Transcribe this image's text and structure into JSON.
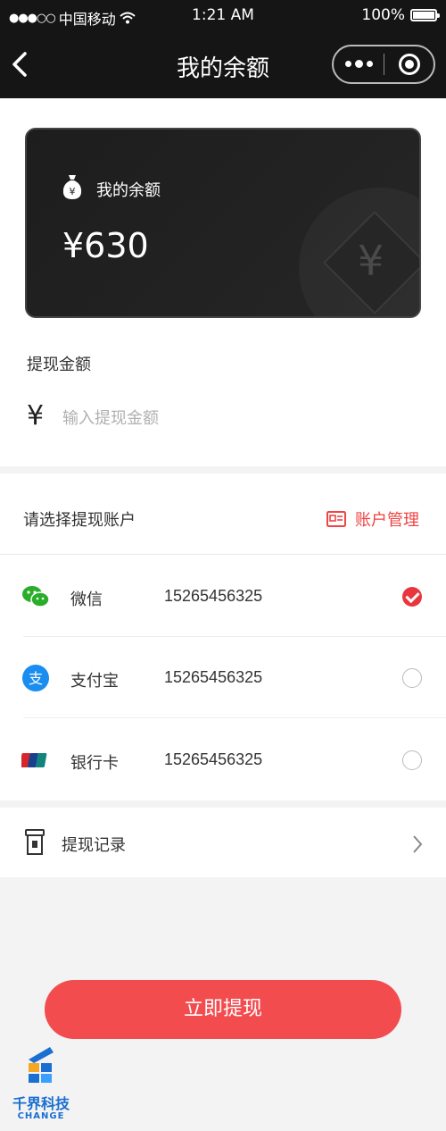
{
  "status_bar": {
    "carrier": "中国移动",
    "time": "1:21 AM",
    "battery": "100%"
  },
  "nav": {
    "title": "我的余额",
    "back_icon": "chevron-left-icon",
    "more_icon": "more-dots-icon",
    "close_icon": "target-circle-icon"
  },
  "balance_card": {
    "label": "我的余额",
    "amount": "¥630",
    "bg_symbol": "¥"
  },
  "withdraw": {
    "title": "提现金额",
    "currency_symbol": "¥",
    "placeholder": "输入提现金额",
    "value": ""
  },
  "accounts": {
    "title": "请选择提现账户",
    "manage_label": "账户管理",
    "items": [
      {
        "name": "微信",
        "account": "15265456325",
        "icon": "wechat-icon",
        "selected": true
      },
      {
        "name": "支付宝",
        "account": "15265456325",
        "icon": "alipay-icon",
        "selected": false
      },
      {
        "name": "银行卡",
        "account": "15265456325",
        "icon": "unionpay-icon",
        "selected": false
      }
    ]
  },
  "records": {
    "label": "提现记录"
  },
  "submit_label": "立即提现",
  "watermark": {
    "cn": "千界科技",
    "en": "CHANGE"
  },
  "colors": {
    "header_bg": "#151515",
    "accent_red": "#f24c4f",
    "check_red": "#e9363c",
    "wechat_green": "#2aae2a",
    "alipay_blue": "#1a8ef0"
  }
}
